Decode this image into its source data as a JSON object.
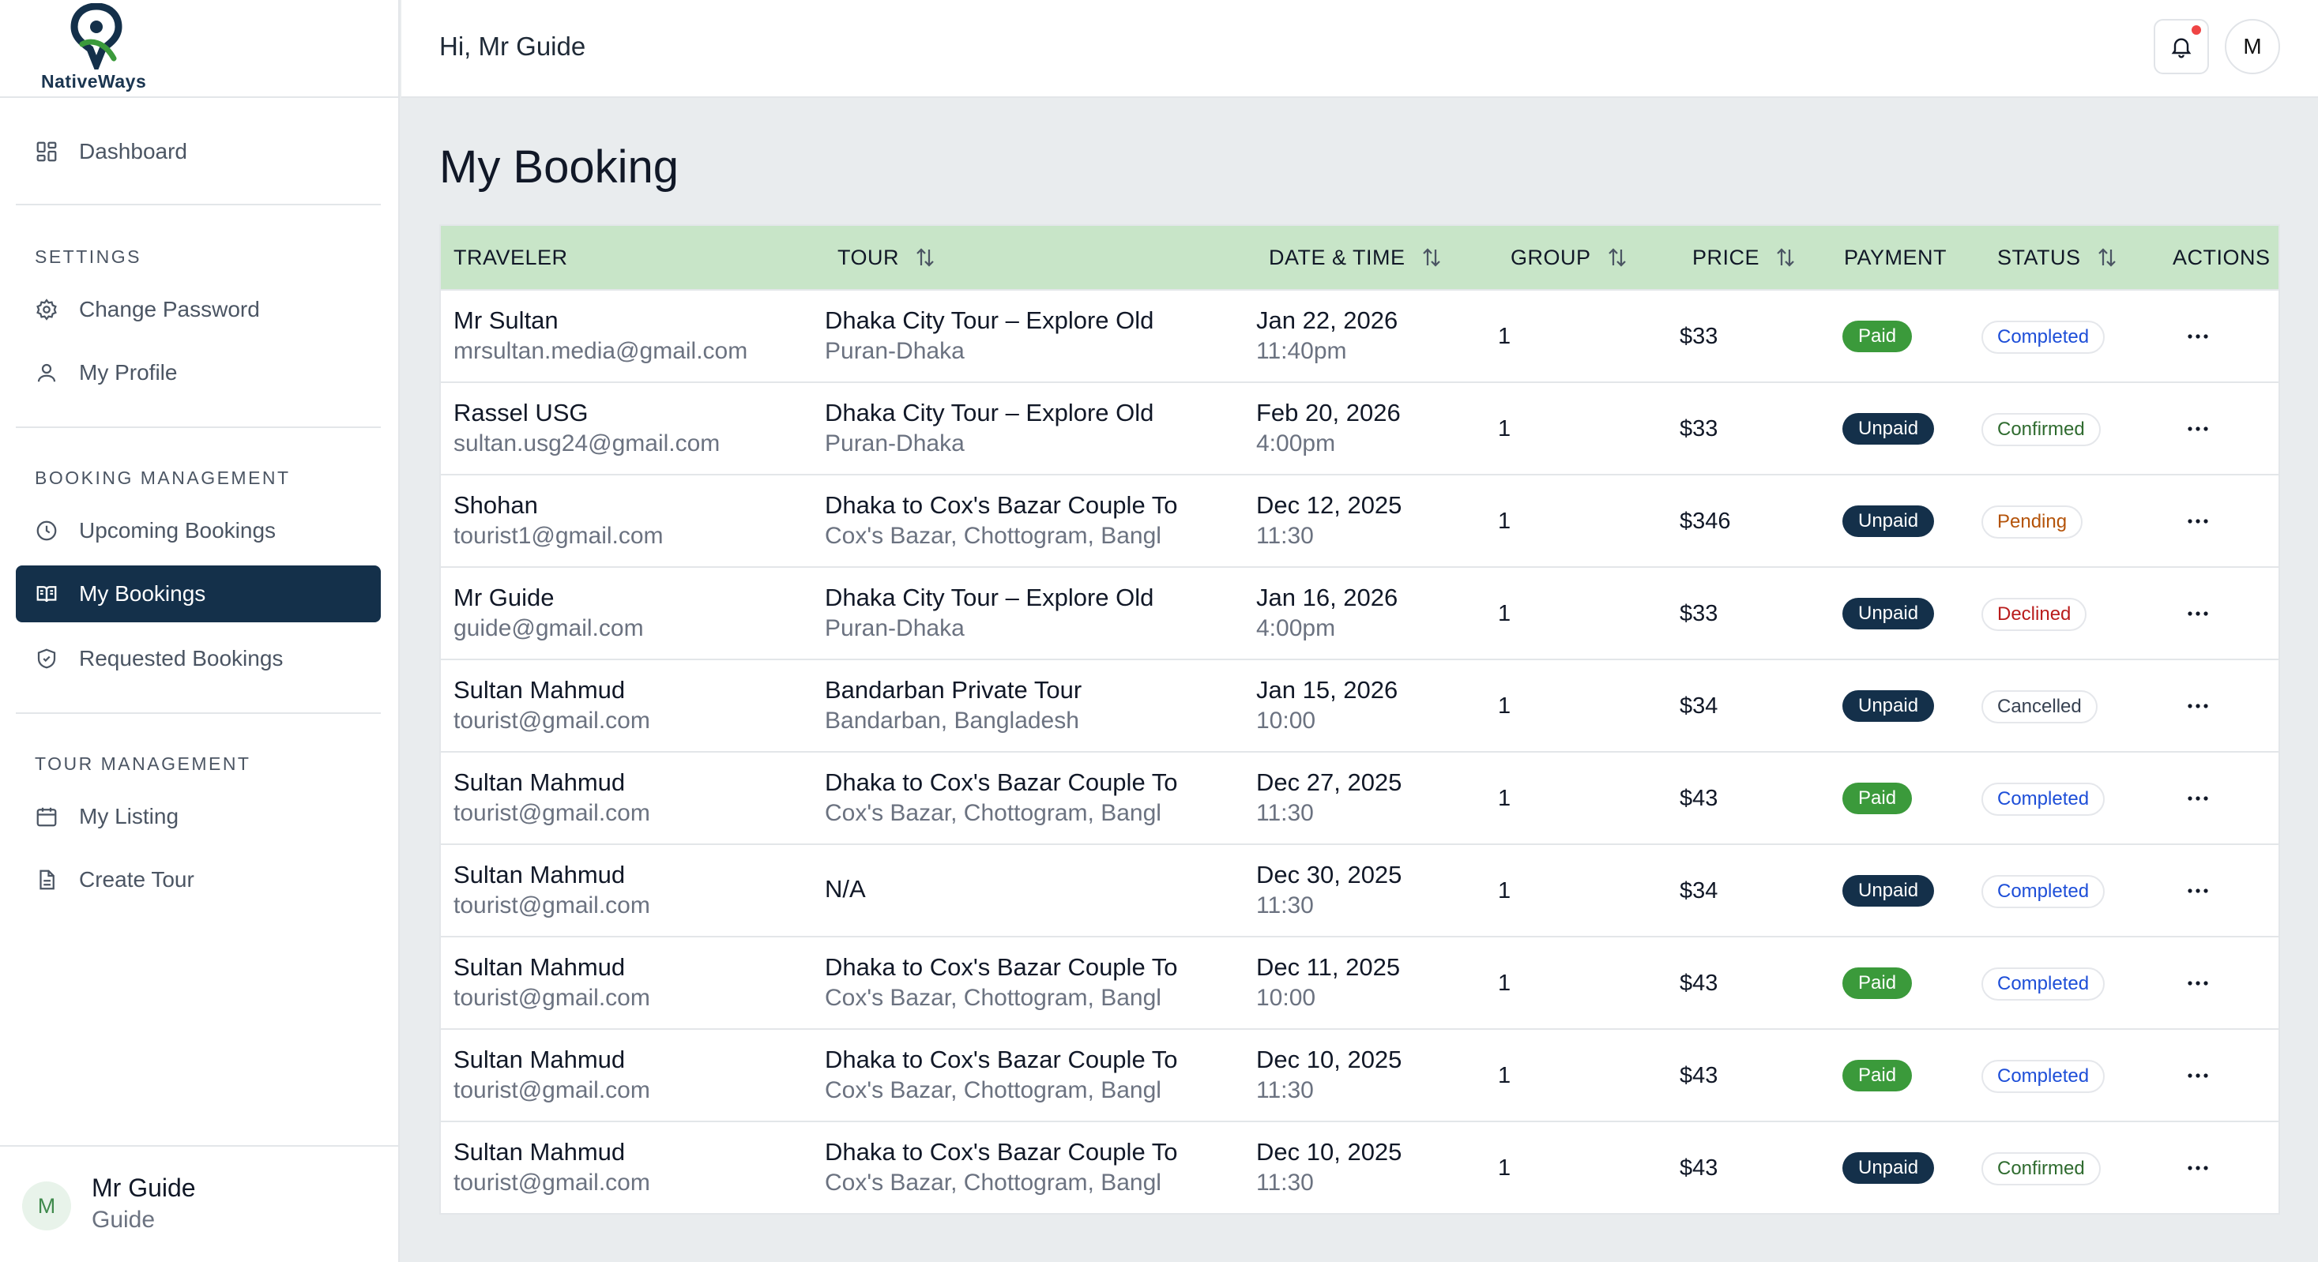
{
  "brand": {
    "name": "NativeWays",
    "colors": {
      "navy": "#14304a",
      "green": "#3b9a3b",
      "header_green": "#c8e5c8"
    }
  },
  "header": {
    "greeting": "Hi, Mr Guide",
    "avatar_initial": "M",
    "bell_icon": "bell-icon",
    "has_notification": true
  },
  "sidebar": {
    "dashboard": {
      "label": "Dashboard",
      "icon": "dashboard-grid-icon"
    },
    "settings_heading": "SETTINGS",
    "settings_items": [
      {
        "label": "Change Password",
        "icon": "gear-icon"
      },
      {
        "label": "My Profile",
        "icon": "user-icon"
      }
    ],
    "booking_heading": "BOOKING MANAGEMENT",
    "booking_items": [
      {
        "label": "Upcoming Bookings",
        "icon": "clock-icon"
      },
      {
        "label": "My Bookings",
        "icon": "book-open-icon",
        "active": true
      },
      {
        "label": "Requested Bookings",
        "icon": "shield-check-icon"
      }
    ],
    "tour_heading": "TOUR MANAGEMENT",
    "tour_items": [
      {
        "label": "My Listing",
        "icon": "calendar-icon"
      },
      {
        "label": "Create Tour",
        "icon": "document-icon"
      }
    ],
    "user": {
      "initial": "M",
      "name": "Mr Guide",
      "role": "Guide"
    }
  },
  "main": {
    "title": "My Booking",
    "columns": [
      "TRAVELER",
      "TOUR",
      "DATE & TIME",
      "GROUP",
      "PRICE",
      "PAYMENT",
      "STATUS",
      "ACTIONS"
    ],
    "rows": [
      {
        "name": "Mr Sultan",
        "email": "mrsultan.media@gmail.com",
        "tour": "Dhaka City Tour – Explore Old",
        "location": "Puran-Dhaka",
        "date": "Jan 22, 2026",
        "time": "11:40pm",
        "group": "1",
        "price": "$33",
        "payment": "Paid",
        "status": "Completed"
      },
      {
        "name": "Rassel USG",
        "email": "sultan.usg24@gmail.com",
        "tour": "Dhaka City Tour – Explore Old",
        "location": "Puran-Dhaka",
        "date": "Feb 20, 2026",
        "time": "4:00pm",
        "group": "1",
        "price": "$33",
        "payment": "Unpaid",
        "status": "Confirmed"
      },
      {
        "name": "Shohan",
        "email": "tourist1@gmail.com",
        "tour": "Dhaka to Cox's Bazar Couple To",
        "location": "Cox's Bazar, Chottogram, Bangl",
        "date": "Dec 12, 2025",
        "time": "11:30",
        "group": "1",
        "price": "$346",
        "payment": "Unpaid",
        "status": "Pending"
      },
      {
        "name": "Mr Guide",
        "email": "guide@gmail.com",
        "tour": "Dhaka City Tour – Explore Old",
        "location": "Puran-Dhaka",
        "date": "Jan 16, 2026",
        "time": "4:00pm",
        "group": "1",
        "price": "$33",
        "payment": "Unpaid",
        "status": "Declined"
      },
      {
        "name": "Sultan Mahmud",
        "email": "tourist@gmail.com",
        "tour": "Bandarban Private Tour",
        "location": "Bandarban, Bangladesh",
        "date": "Jan 15, 2026",
        "time": "10:00",
        "group": "1",
        "price": "$34",
        "payment": "Unpaid",
        "status": "Cancelled"
      },
      {
        "name": "Sultan Mahmud",
        "email": "tourist@gmail.com",
        "tour": "Dhaka to Cox's Bazar Couple To",
        "location": "Cox's Bazar, Chottogram, Bangl",
        "date": "Dec 27, 2025",
        "time": "11:30",
        "group": "1",
        "price": "$43",
        "payment": "Paid",
        "status": "Completed"
      },
      {
        "name": "Sultan Mahmud",
        "email": "tourist@gmail.com",
        "tour": "N/A",
        "location": "",
        "date": "Dec 30, 2025",
        "time": "11:30",
        "group": "1",
        "price": "$34",
        "payment": "Unpaid",
        "status": "Completed"
      },
      {
        "name": "Sultan Mahmud",
        "email": "tourist@gmail.com",
        "tour": "Dhaka to Cox's Bazar Couple To",
        "location": "Cox's Bazar, Chottogram, Bangl",
        "date": "Dec 11, 2025",
        "time": "10:00",
        "group": "1",
        "price": "$43",
        "payment": "Paid",
        "status": "Completed"
      },
      {
        "name": "Sultan Mahmud",
        "email": "tourist@gmail.com",
        "tour": "Dhaka to Cox's Bazar Couple To",
        "location": "Cox's Bazar, Chottogram, Bangl",
        "date": "Dec 10, 2025",
        "time": "11:30",
        "group": "1",
        "price": "$43",
        "payment": "Paid",
        "status": "Completed"
      },
      {
        "name": "Sultan Mahmud",
        "email": "tourist@gmail.com",
        "tour": "Dhaka to Cox's Bazar Couple To",
        "location": "Cox's Bazar, Chottogram, Bangl",
        "date": "Dec 10, 2025",
        "time": "11:30",
        "group": "1",
        "price": "$43",
        "payment": "Unpaid",
        "status": "Confirmed"
      }
    ],
    "status_colors": {
      "Completed": "#1d4ed8",
      "Confirmed": "#2f6b2f",
      "Pending": "#b45309",
      "Declined": "#b91c1c",
      "Cancelled": "#374151"
    }
  }
}
